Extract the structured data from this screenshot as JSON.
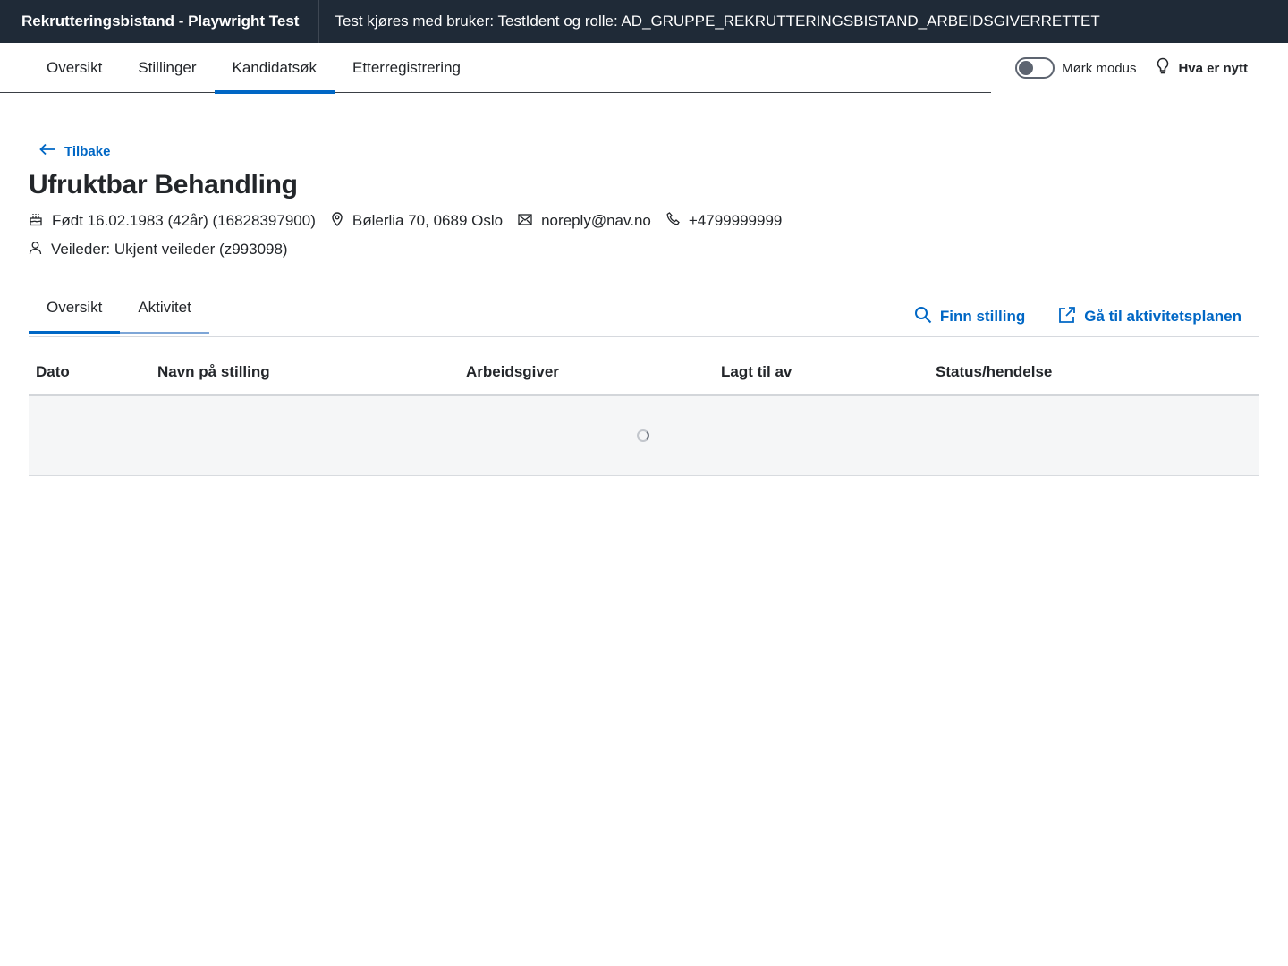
{
  "topbar": {
    "brand": "Rekrutteringsbistand - Playwright Test",
    "testinfo": "Test kjøres med bruker: TestIdent og rolle: AD_GRUPPE_REKRUTTERINGSBISTAND_ARBEIDSGIVERRETTET"
  },
  "nav": {
    "tabs": [
      "Oversikt",
      "Stillinger",
      "Kandidatsøk",
      "Etterregistrering"
    ],
    "active_tab": "Kandidatsøk",
    "dark_mode_label": "Mørk modus",
    "whats_new_label": "Hva er nytt"
  },
  "candidate": {
    "back_label": "Tilbake",
    "name": "Ufruktbar Behandling",
    "born": "Født 16.02.1983 (42år) (16828397900)",
    "address": "Bølerlia 70, 0689 Oslo",
    "email": "noreply@nav.no",
    "phone": "+4799999999",
    "supervisor": "Veileder: Ukjent veileder (z993098)"
  },
  "subtabs": [
    "Oversikt",
    "Aktivitet"
  ],
  "actions": {
    "find_job": "Finn stilling",
    "activity_plan": "Gå til aktivitetsplanen"
  },
  "table": {
    "headers": [
      "Dato",
      "Navn på stilling",
      "Arbeidsgiver",
      "Lagt til av",
      "Status/hendelse"
    ]
  },
  "colors": {
    "header_bg": "#1f2a37",
    "accent": "#0067c5"
  }
}
